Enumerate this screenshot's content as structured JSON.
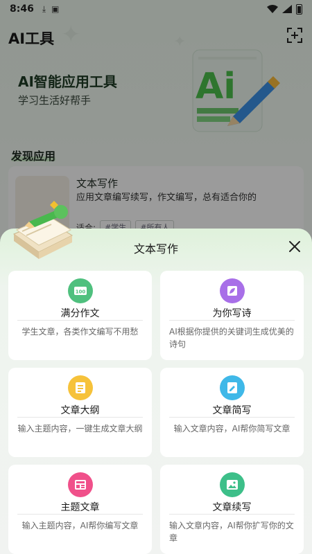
{
  "status_bar": {
    "time": "8:46"
  },
  "app": {
    "title": "AI工具"
  },
  "banner": {
    "title": "AI智能应用工具",
    "subtitle": "学习生活好帮手"
  },
  "section": {
    "title": "发现应用"
  },
  "background_card": {
    "title": "文本写作",
    "description": "应用文章编写续写，作文编写，总有适合你的",
    "fit_label": "适合:",
    "tags": [
      "#学生",
      "#所有人"
    ]
  },
  "sheet": {
    "title": "文本写作",
    "cards": [
      {
        "title": "满分作文",
        "description": "学生文章，各类作文编写不用愁",
        "icon": "score-100-icon",
        "color": "#4fc07e"
      },
      {
        "title": "为你写诗",
        "description": "AI根据你提供的关键词生成优美的诗句",
        "icon": "leaf-icon",
        "color": "#a86fe8"
      },
      {
        "title": "文章大纲",
        "description": "输入主题内容，一键生成文章大纲",
        "icon": "document-icon",
        "color": "#f6c23a"
      },
      {
        "title": "文章简写",
        "description": "输入文章内容，AI帮你简写文章",
        "icon": "edit-doc-icon",
        "color": "#3fb8e8"
      },
      {
        "title": "主题文章",
        "description": "输入主题内容，AI帮你编写文章",
        "icon": "layout-icon",
        "color": "#f0508a"
      },
      {
        "title": "文章续写",
        "description": "输入文章内容，AI帮你扩写你的文章",
        "icon": "image-doc-icon",
        "color": "#3dbf89"
      }
    ]
  }
}
